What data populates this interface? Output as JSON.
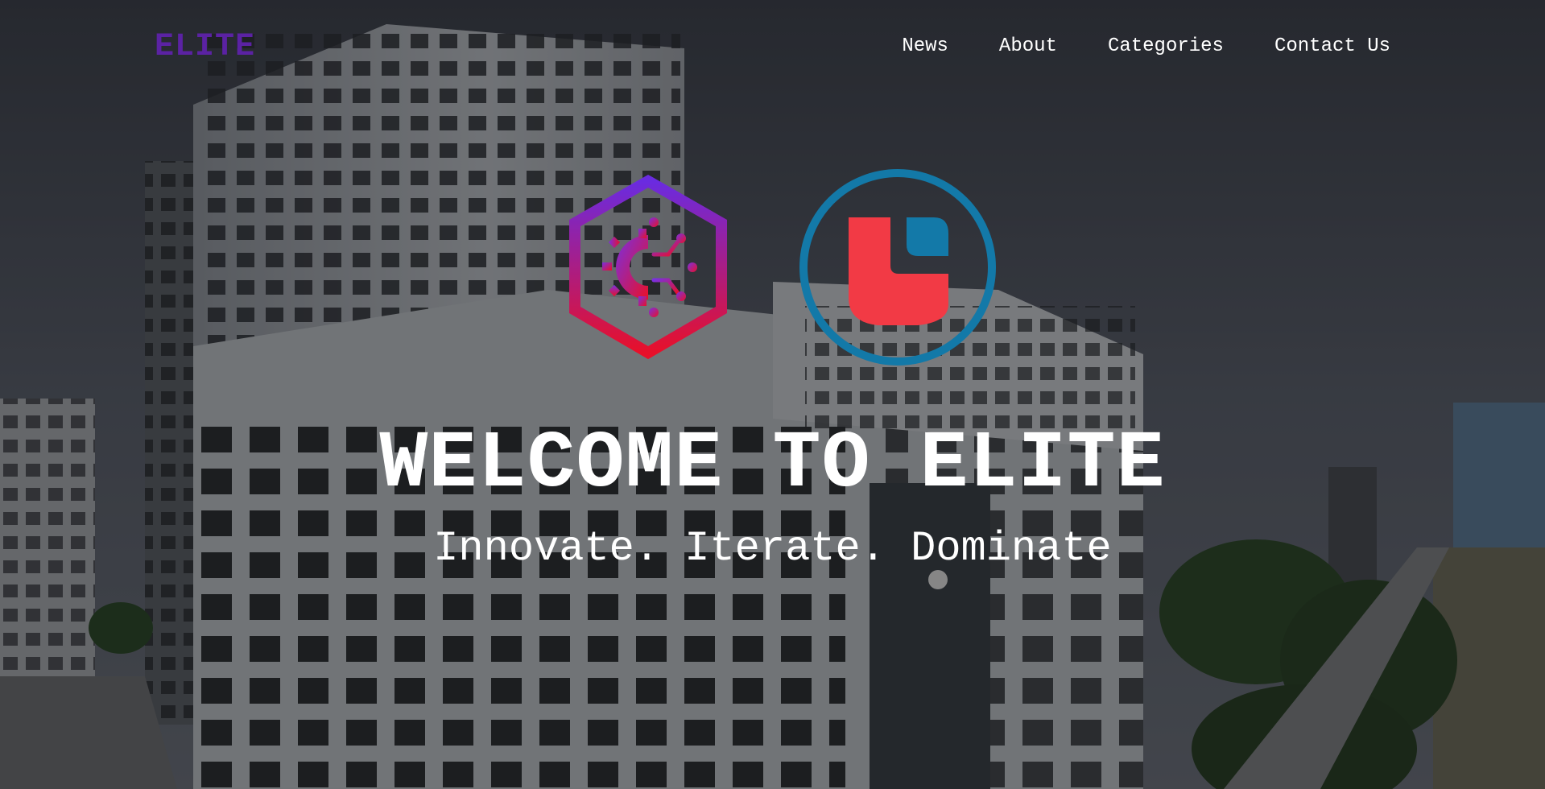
{
  "brand": {
    "name": "ELITE",
    "color": "#5b22a3"
  },
  "nav": {
    "items": [
      {
        "label": "News"
      },
      {
        "label": "About"
      },
      {
        "label": "Categories"
      },
      {
        "label": "Contact Us"
      }
    ]
  },
  "hero": {
    "title": "WELCOME TO ELITE",
    "subtitle": "Innovate. Iterate. Dominate",
    "background_image": "city-buildings-street-photo"
  },
  "logos": [
    {
      "icon": "hexagon-gear-circuit-icon",
      "colors": [
        "#6a2be0",
        "#e8102a"
      ]
    },
    {
      "icon": "circle-shield-u-icon",
      "colors": [
        "#1379a8",
        "#f23a45"
      ]
    }
  ]
}
